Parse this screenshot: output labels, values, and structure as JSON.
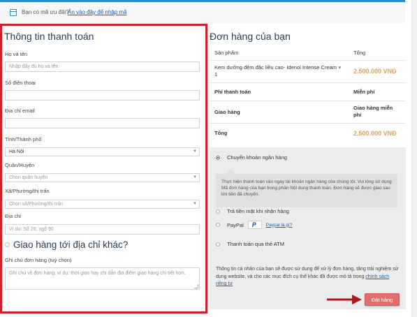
{
  "coupon": {
    "text": "Bạn có mã ưu đãi?",
    "link": "Ấn vào đây để nhập mã"
  },
  "billing": {
    "title": "Thông tin thanh toán",
    "fields": {
      "name_label": "Họ và tên",
      "name_placeholder": "Nhập đầy đủ họ và tên",
      "phone_label": "Số điện thoại",
      "email_label": "Địa chỉ email",
      "city_label": "Tỉnh/Thành phố",
      "city_value": "Hà Nội",
      "district_label": "Quận/Huyện",
      "district_placeholder": "Chọn quận huyện",
      "ward_label": "Xã/Phường/thị trấn",
      "ward_placeholder": "Chọn xã/Phường/thị trấn",
      "address_label": "Địa chỉ",
      "address_placeholder": "Ví dụ: Số 20, ngõ 90"
    },
    "ship_other": "Giao hàng tới địa chỉ khác?",
    "notes_label": "Ghi chú đơn hàng (tuỳ chọn)",
    "notes_placeholder": "Ghi chú về đơn hàng, ví dụ: thời gian hay chỉ dẫn địa điểm giao hàng chi tiết hơn."
  },
  "order": {
    "title": "Đơn hàng của bạn",
    "col_product": "Sản phẩm",
    "col_total": "Tổng",
    "item_name": "Kem dưỡng đệm đặc liều cao- Idenol Intense Cream × 1",
    "item_total": "2.500.000 VNĐ",
    "ship_fee_label": "Phí thanh toán",
    "ship_fee_value": "Miễn phí",
    "delivery_label": "Giao hàng",
    "delivery_value": "Giao hàng miễn phí",
    "total_label": "Tổng",
    "total_value": "2.500.000 VNĐ"
  },
  "payment": {
    "bank_label": "Chuyển khoản ngân hàng",
    "bank_desc": "Thực hiện thanh toán vào ngay tài khoản ngân hàng của chúng tôi. Vui lòng sử dụng Mã đơn hàng của bạn trong phần Nội dung thanh toán. Đơn hàng sẽ được giao sau khi tiền đã chuyển.",
    "cod_label": "Trả tiền mặt khi nhận hàng",
    "paypal_label": "PayPal",
    "paypal_link": "Paypal là gì?",
    "atm_label": "Thanh toán qua thẻ ATM",
    "privacy_text": "Thông tin cá nhân của bạn sẽ được sử dụng để xử lý đơn hàng, tăng trải nghiệm sử dụng website, và cho các mục đích cụ thể khác đã được mô tả trong",
    "privacy_link": "chính sách riêng tư",
    "place_order": "Đặt hàng"
  },
  "colors": {
    "highlight_border": "#d0202a",
    "price": "#d9a45a",
    "order_button": "#e36d6d",
    "arrow": "#b0171f"
  }
}
